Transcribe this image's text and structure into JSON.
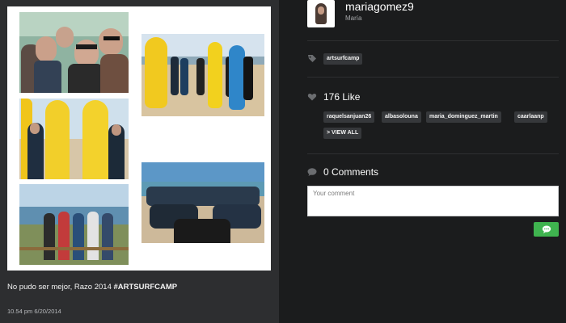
{
  "post": {
    "caption_text": "No pudo ser mejor, Razo 2014 ",
    "caption_hashtag": "#ARTSURFCAMP",
    "timestamp": "10.54 pm 6/20/2014"
  },
  "user": {
    "username": "mariagomez9",
    "real_name": "María"
  },
  "tags": {
    "icon": "tag-icon",
    "items": [
      "artsurfcamp"
    ]
  },
  "likes": {
    "icon": "heart-icon",
    "count_label": "176 Like",
    "users": [
      "raquelsanjuan26",
      "albasolouna",
      "maria_dominguez_martin",
      "caarlaanp"
    ],
    "view_all_label": "> VIEW ALL"
  },
  "comments": {
    "icon": "speech-bubble-icon",
    "count_label": "0 Comments",
    "placeholder": "Your comment",
    "send_icon": "chat-bubble-icon"
  },
  "colors": {
    "left_bg": "#2d2e30",
    "right_bg": "#1b1c1d",
    "tag_bg": "#36383b",
    "send_green": "#3fb34f"
  }
}
